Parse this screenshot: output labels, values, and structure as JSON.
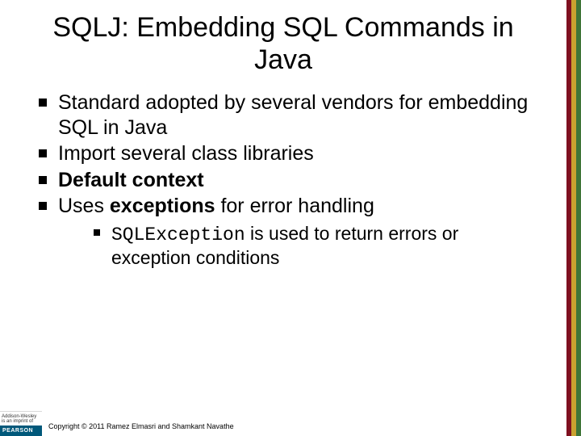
{
  "title": "SQLJ: Embedding SQL Commands in Java",
  "bullets": {
    "b1a": "Standard adopted by several vendors for embedding SQL in Java",
    "b2a": "Import several class libraries",
    "b3a": "Default context",
    "b4a": "Uses ",
    "b4b": "exceptions",
    "b4c": " for error handling",
    "sub1a": "SQLException",
    "sub1b": " is used to return errors or exception conditions"
  },
  "footer": {
    "publisher_small": "Addison-Wesley",
    "publisher_tag": "is an imprint of",
    "brand": "PEARSON",
    "copyright": "Copyright © 2011 Ramez Elmasri and Shamkant Navathe"
  }
}
